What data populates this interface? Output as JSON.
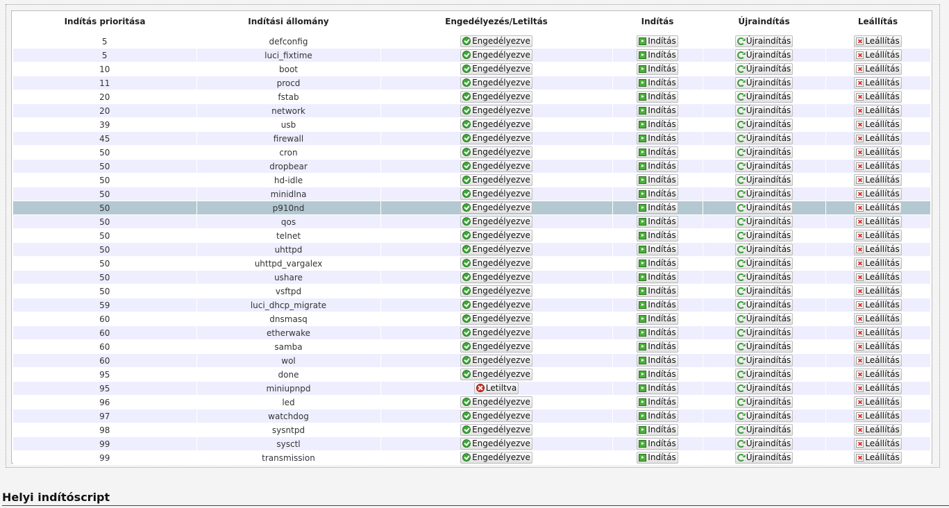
{
  "columns": [
    "Indítás prioritása",
    "Indítási állomány",
    "Engedélyezés/Letiltás",
    "Indítás",
    "Újraindítás",
    "Leállítás"
  ],
  "labels": {
    "enabled": "Engedélyezve",
    "disabled": "Letiltva",
    "start": "Indítás",
    "restart": "Újraindítás",
    "stop": "Leállítás"
  },
  "rows": [
    {
      "priority": "5",
      "name": "defconfig",
      "enabled": true
    },
    {
      "priority": "5",
      "name": "luci_fixtime",
      "enabled": true
    },
    {
      "priority": "10",
      "name": "boot",
      "enabled": true
    },
    {
      "priority": "11",
      "name": "procd",
      "enabled": true
    },
    {
      "priority": "20",
      "name": "fstab",
      "enabled": true
    },
    {
      "priority": "20",
      "name": "network",
      "enabled": true
    },
    {
      "priority": "39",
      "name": "usb",
      "enabled": true
    },
    {
      "priority": "45",
      "name": "firewall",
      "enabled": true
    },
    {
      "priority": "50",
      "name": "cron",
      "enabled": true
    },
    {
      "priority": "50",
      "name": "dropbear",
      "enabled": true
    },
    {
      "priority": "50",
      "name": "hd-idle",
      "enabled": true
    },
    {
      "priority": "50",
      "name": "minidlna",
      "enabled": true
    },
    {
      "priority": "50",
      "name": "p910nd",
      "enabled": true,
      "highlighted": true
    },
    {
      "priority": "50",
      "name": "qos",
      "enabled": true
    },
    {
      "priority": "50",
      "name": "telnet",
      "enabled": true
    },
    {
      "priority": "50",
      "name": "uhttpd",
      "enabled": true
    },
    {
      "priority": "50",
      "name": "uhttpd_vargalex",
      "enabled": true
    },
    {
      "priority": "50",
      "name": "ushare",
      "enabled": true
    },
    {
      "priority": "50",
      "name": "vsftpd",
      "enabled": true
    },
    {
      "priority": "59",
      "name": "luci_dhcp_migrate",
      "enabled": true
    },
    {
      "priority": "60",
      "name": "dnsmasq",
      "enabled": true
    },
    {
      "priority": "60",
      "name": "etherwake",
      "enabled": true
    },
    {
      "priority": "60",
      "name": "samba",
      "enabled": true
    },
    {
      "priority": "60",
      "name": "wol",
      "enabled": true
    },
    {
      "priority": "95",
      "name": "done",
      "enabled": true
    },
    {
      "priority": "95",
      "name": "miniupnpd",
      "enabled": false
    },
    {
      "priority": "96",
      "name": "led",
      "enabled": true
    },
    {
      "priority": "97",
      "name": "watchdog",
      "enabled": true
    },
    {
      "priority": "98",
      "name": "sysntpd",
      "enabled": true
    },
    {
      "priority": "99",
      "name": "sysctl",
      "enabled": true
    },
    {
      "priority": "99",
      "name": "transmission",
      "enabled": true
    }
  ],
  "section_title": "Helyi indítóscript"
}
